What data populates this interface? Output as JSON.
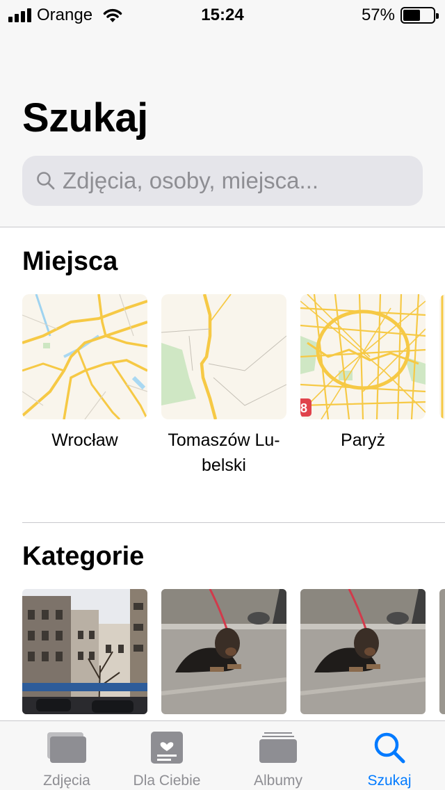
{
  "status_bar": {
    "carrier": "Orange",
    "time": "15:24",
    "battery_percent": "57%",
    "battery_level": 0.57
  },
  "header": {
    "title": "Szukaj",
    "search_placeholder": "Zdjęcia, osoby, miejsca..."
  },
  "places": {
    "title": "Miejsca",
    "items": [
      {
        "label": "Wrocław"
      },
      {
        "label": "Tomaszów Lu-\nbelski"
      },
      {
        "label": "Paryż"
      }
    ]
  },
  "categories": {
    "title": "Kategorie"
  },
  "map_badge": "8",
  "tab_bar": {
    "tabs": [
      {
        "label": "Zdjęcia",
        "icon": "photos-icon"
      },
      {
        "label": "Dla Ciebie",
        "icon": "for-you-icon"
      },
      {
        "label": "Albumy",
        "icon": "albums-icon"
      },
      {
        "label": "Szukaj",
        "icon": "search-icon",
        "active": true
      }
    ]
  },
  "colors": {
    "accent": "#007aff",
    "map_road": "#f6c945",
    "map_bg": "#f9f5ec"
  }
}
